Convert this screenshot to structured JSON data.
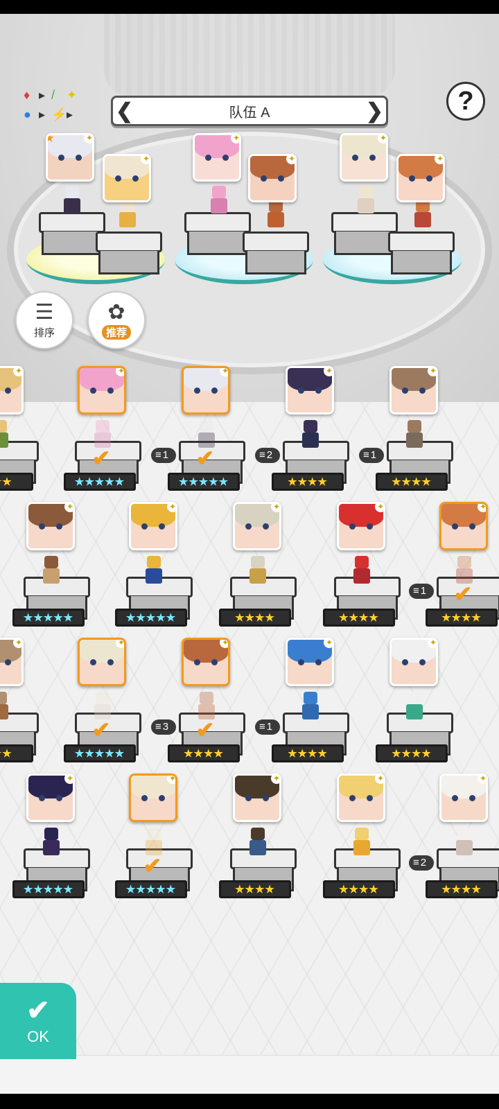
{
  "header": {
    "team_name": "队伍 A",
    "prev_arrow": "❮",
    "next_arrow": "❯",
    "help_label": "?"
  },
  "element_legend": {
    "symbols": [
      "♦",
      "▸",
      "/",
      "✦",
      "●",
      "▸",
      "⚡",
      "▸",
      "✦"
    ],
    "colors": [
      "#e23b3b",
      "#333333",
      "#3fb24a",
      "#e6c200",
      "#2a7fe0",
      "#333333",
      "#f5c400",
      "#333333",
      "#5a2d82"
    ]
  },
  "side_buttons": {
    "sort": {
      "label": "排序",
      "icon": "sort-icon"
    },
    "recommend": {
      "label": "推荐",
      "icon": "flower-icon"
    }
  },
  "ok_button": {
    "label": "OK",
    "icon": "check-icon"
  },
  "colors": {
    "selected_border": "#f29a1c",
    "ok_button": "#2fc3b0",
    "rating_gold": "#ffcf2e",
    "rating_rainbow": "#7be6ff"
  },
  "team_slots": [
    {
      "hair": "#e8e8f0",
      "skin": "#f2d3c0",
      "body": "#3a2f4a",
      "leader": true
    },
    {
      "hair": "#f0e6d0",
      "skin": "#f7d080",
      "body": "#e8b040",
      "leader": false
    },
    {
      "hair": "#f2a3cc",
      "skin": "#f8ddd6",
      "body": "#d880b0",
      "leader": false
    },
    {
      "hair": "#b8683c",
      "skin": "#f5d2bf",
      "body": "#c06030",
      "leader": false
    },
    {
      "hair": "#ede6cf",
      "skin": "#f7e1d4",
      "body": "#e0d0c0",
      "leader": false
    },
    {
      "hair": "#d47a45",
      "skin": "#f8d7c6",
      "body": "#b84838",
      "leader": false
    }
  ],
  "roster": [
    {
      "hair": "#e7c27a",
      "stars": "★★★",
      "rainbow": false,
      "selected": false,
      "count": null,
      "body": "#6b8f3a"
    },
    {
      "hair": "#f2a3cc",
      "stars": "★★★★★",
      "rainbow": true,
      "selected": true,
      "count": null,
      "body": "#d880b0"
    },
    {
      "hair": "#e8e8f0",
      "stars": "★★★★★",
      "rainbow": true,
      "selected": true,
      "count": "1",
      "body": "#3a2f4a"
    },
    {
      "hair": "#3a2f55",
      "stars": "★★★★",
      "rainbow": false,
      "selected": false,
      "count": "2",
      "body": "#2c3050"
    },
    {
      "hair": "#9c7a60",
      "stars": "★★★★",
      "rainbow": false,
      "selected": false,
      "count": "1",
      "body": "#7a6a5a"
    },
    {
      "hair": "#8a5a3a",
      "stars": "★★★★★",
      "rainbow": true,
      "selected": false,
      "count": null,
      "body": "#c8a070"
    },
    {
      "hair": "#e9b53a",
      "stars": "★★★★★",
      "rainbow": true,
      "selected": false,
      "count": null,
      "body": "#2a4a9a"
    },
    {
      "hair": "#d8d2c0",
      "stars": "★★★★",
      "rainbow": false,
      "selected": false,
      "count": null,
      "body": "#c8a048"
    },
    {
      "hair": "#d8302f",
      "stars": "★★★★",
      "rainbow": false,
      "selected": false,
      "count": null,
      "body": "#b02a30"
    },
    {
      "hair": "#d47a45",
      "stars": "★★★★",
      "rainbow": false,
      "selected": true,
      "count": "1",
      "body": "#b84838"
    },
    {
      "hair": "#b09070",
      "stars": "★★★",
      "rainbow": false,
      "selected": false,
      "count": null,
      "body": "#a06a40"
    },
    {
      "hair": "#ede6cf",
      "stars": "★★★★★",
      "rainbow": true,
      "selected": true,
      "count": null,
      "body": "#e0d0c0"
    },
    {
      "hair": "#b8683c",
      "stars": "★★★★",
      "rainbow": false,
      "selected": true,
      "count": "3",
      "body": "#c06030"
    },
    {
      "hair": "#3a7fcf",
      "stars": "★★★★",
      "rainbow": false,
      "selected": false,
      "count": "1",
      "body": "#2f6ab0"
    },
    {
      "hair": "#f0f0f0",
      "stars": "★★★★",
      "rainbow": false,
      "selected": false,
      "count": null,
      "body": "#3aa88a"
    },
    {
      "hair": "#2a2450",
      "stars": "★★★★★",
      "rainbow": true,
      "selected": false,
      "count": null,
      "body": "#3a2a5a"
    },
    {
      "hair": "#f0e6d0",
      "stars": "★★★★★",
      "rainbow": true,
      "selected": true,
      "count": null,
      "body": "#e8b040"
    },
    {
      "hair": "#4a3a2a",
      "stars": "★★★★",
      "rainbow": false,
      "selected": false,
      "count": null,
      "body": "#3a5a8a"
    },
    {
      "hair": "#f0d070",
      "stars": "★★★★",
      "rainbow": false,
      "selected": false,
      "count": null,
      "body": "#e8a830"
    },
    {
      "hair": "#f4f0ec",
      "stars": "★★★★",
      "rainbow": false,
      "selected": false,
      "count": "2",
      "body": "#d0c0b8"
    }
  ]
}
